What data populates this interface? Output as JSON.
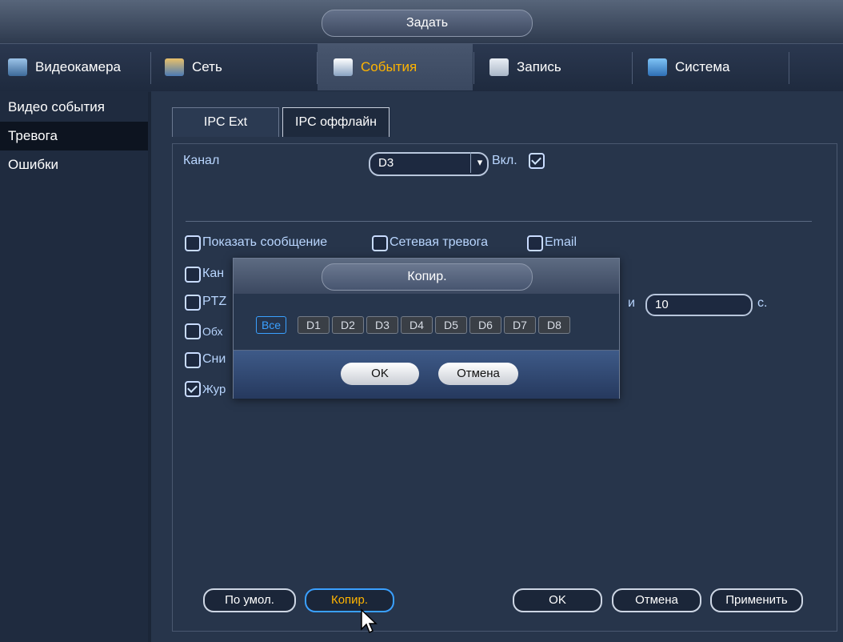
{
  "window": {
    "title": "Задать"
  },
  "nav": {
    "tabs": [
      {
        "label": "Видеокамера",
        "icon": "camera-icon",
        "active": false
      },
      {
        "label": "Сеть",
        "icon": "network-icon",
        "active": false
      },
      {
        "label": "События",
        "icon": "events-icon",
        "active": true
      },
      {
        "label": "Запись",
        "icon": "record-icon",
        "active": false
      },
      {
        "label": "Система",
        "icon": "system-icon",
        "active": false
      }
    ]
  },
  "sidebar": {
    "items": [
      {
        "label": "Видео события",
        "active": false
      },
      {
        "label": "Тревога",
        "active": true
      },
      {
        "label": "Ошибки",
        "active": false
      }
    ]
  },
  "subtabs": [
    {
      "label": "IPC Ext",
      "active": false
    },
    {
      "label": "IPC оффлайн",
      "active": true
    }
  ],
  "form": {
    "channel_label": "Канал",
    "channel_value": "D3",
    "enable_label": "Вкл.",
    "enable_checked": true,
    "show_message_label": "Показать сообщение",
    "net_alarm_label": "Сетевая тревога",
    "email_label": "Email",
    "row_channel_label": "Кан",
    "row_ptz_label": "PTZ",
    "row_tour_label": "Обх",
    "row_snapshot_label": "Сни",
    "row_log_label": "Жур",
    "log_checked": true,
    "delay_suffix_label": "и",
    "delay_value": "10",
    "delay_unit": "с."
  },
  "buttons": {
    "default": "По умол.",
    "copy": "Копир.",
    "ok": "OK",
    "cancel": "Отмена",
    "apply": "Применить"
  },
  "dialog": {
    "title": "Копир.",
    "all_label": "Все",
    "channels": [
      "D1",
      "D2",
      "D3",
      "D4",
      "D5",
      "D6",
      "D7",
      "D8"
    ],
    "ok": "OK",
    "cancel": "Отмена"
  },
  "colors": {
    "accent": "#ffb400",
    "label": "#b9d6ff",
    "highlight": "#3aa0ff"
  }
}
